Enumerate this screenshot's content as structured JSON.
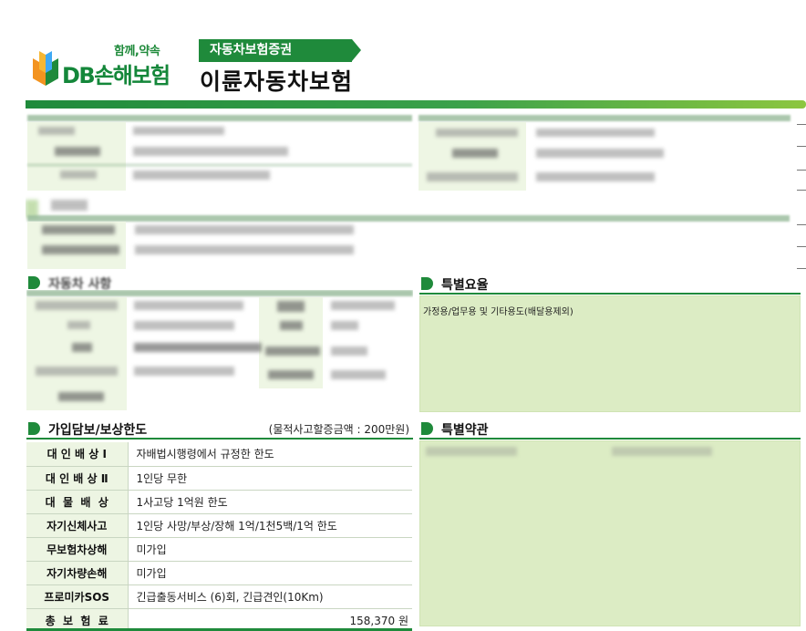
{
  "header": {
    "logo_tagline": "함께,약속",
    "logo_brand": "DB손해보험",
    "doc_tag": "자동차보험증권",
    "doc_title": "이륜자동차보험"
  },
  "sections": {
    "vehicle": {
      "title": "자동차 사항"
    },
    "special_rate": {
      "title": "특별요율",
      "text": "가정용/업무용 및 기타용도(배달용제외)"
    },
    "coverage": {
      "title": "가입담보/보상한도",
      "note": "(물적사고할증금액 : 200만원)"
    },
    "special_terms": {
      "title": "특별약관"
    }
  },
  "coverage_rows": [
    {
      "label": "대 인 배 상 Ⅰ",
      "value": "자배법시행령에서 규정한 한도"
    },
    {
      "label": "대 인 배 상 Ⅱ",
      "value": "1인당 무한"
    },
    {
      "label": "대  물  배  상",
      "value": "1사고당 1억원 한도"
    },
    {
      "label": "자기신체사고",
      "value": "1인당 사망/부상/장해 1억/1천5백/1억 한도"
    },
    {
      "label": "무보험차상해",
      "value": "미가입"
    },
    {
      "label": "자기차량손해",
      "value": "미가입"
    },
    {
      "label": "프로미카SOS",
      "value": "긴급출동서비스 (6)회, 긴급견인(10Km)"
    },
    {
      "label": "총  보  험  료",
      "value": "158,370 원"
    }
  ],
  "colors": {
    "brand_green": "#1f8a3b",
    "panel_green": "#dcecc4",
    "label_bg": "#edf5e3"
  }
}
